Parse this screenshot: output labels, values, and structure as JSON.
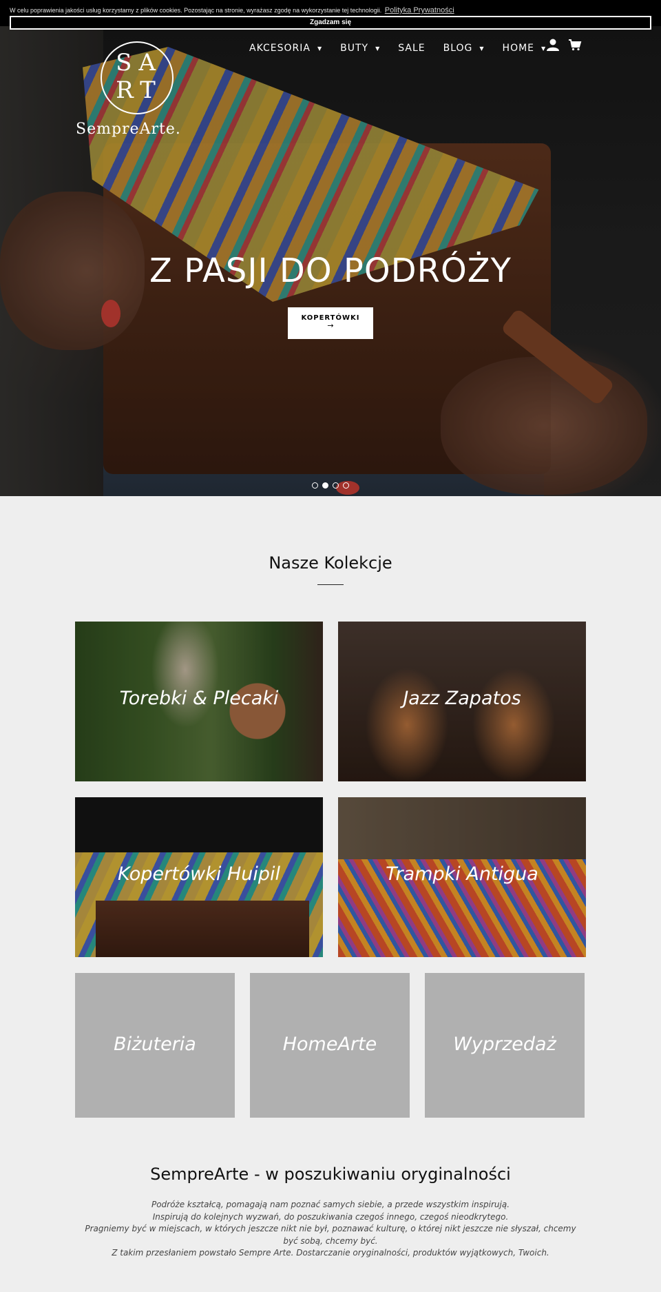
{
  "cookie": {
    "text": "W celu poprawienia jakości usług korzystamy z plików cookies. Pozostając na stronie, wyrażasz zgodę na wykorzystanie tej technologii.",
    "link": "Polityka Prywatności",
    "accept": "Zgadzam się"
  },
  "brand": {
    "mono_top": "SA",
    "mono_bottom": "RT",
    "wordmark": "SempreArte."
  },
  "nav": {
    "items": [
      {
        "label": "AKCESORIA",
        "dropdown": true
      },
      {
        "label": "BUTY",
        "dropdown": true
      },
      {
        "label": "SALE",
        "dropdown": false
      },
      {
        "label": "BLOG",
        "dropdown": true
      },
      {
        "label": "HOME",
        "dropdown": true
      }
    ],
    "account_icon": "user-icon",
    "cart_icon": "cart-icon"
  },
  "hero": {
    "title": "Z PASJI DO PODRÓŻY",
    "button_label": "KOPERTÓWKI",
    "button_arrow": "→",
    "slides": 4,
    "active_slide": 2
  },
  "collections": {
    "title": "Nasze Kolekcje",
    "items": [
      "Torebki & Plecaki",
      "Jazz Zapatos",
      "Kopertówki Huipil",
      "Trampki Antigua",
      "Biżuteria",
      "HomeArte",
      "Wyprzedaż"
    ]
  },
  "about": {
    "title": "SempreArte - w poszukiwaniu oryginalności",
    "lines": [
      "Podróże kształcą, pomagają nam poznać samych siebie, a przede wszystkim inspirują.",
      "Inspirują do kolejnych wyzwań, do poszukiwania czegoś innego, czegoś nieodkrytego.",
      "Pragniemy być w miejscach, w których jeszcze nikt nie był, poznawać kulturę, o której nikt jeszcze nie słyszał, chcemy być sobą, chcemy być.",
      "Z takim przesłaniem powstało Sempre Arte. Dostarczanie oryginalności, produktów wyjątkowych, Twoich."
    ]
  }
}
